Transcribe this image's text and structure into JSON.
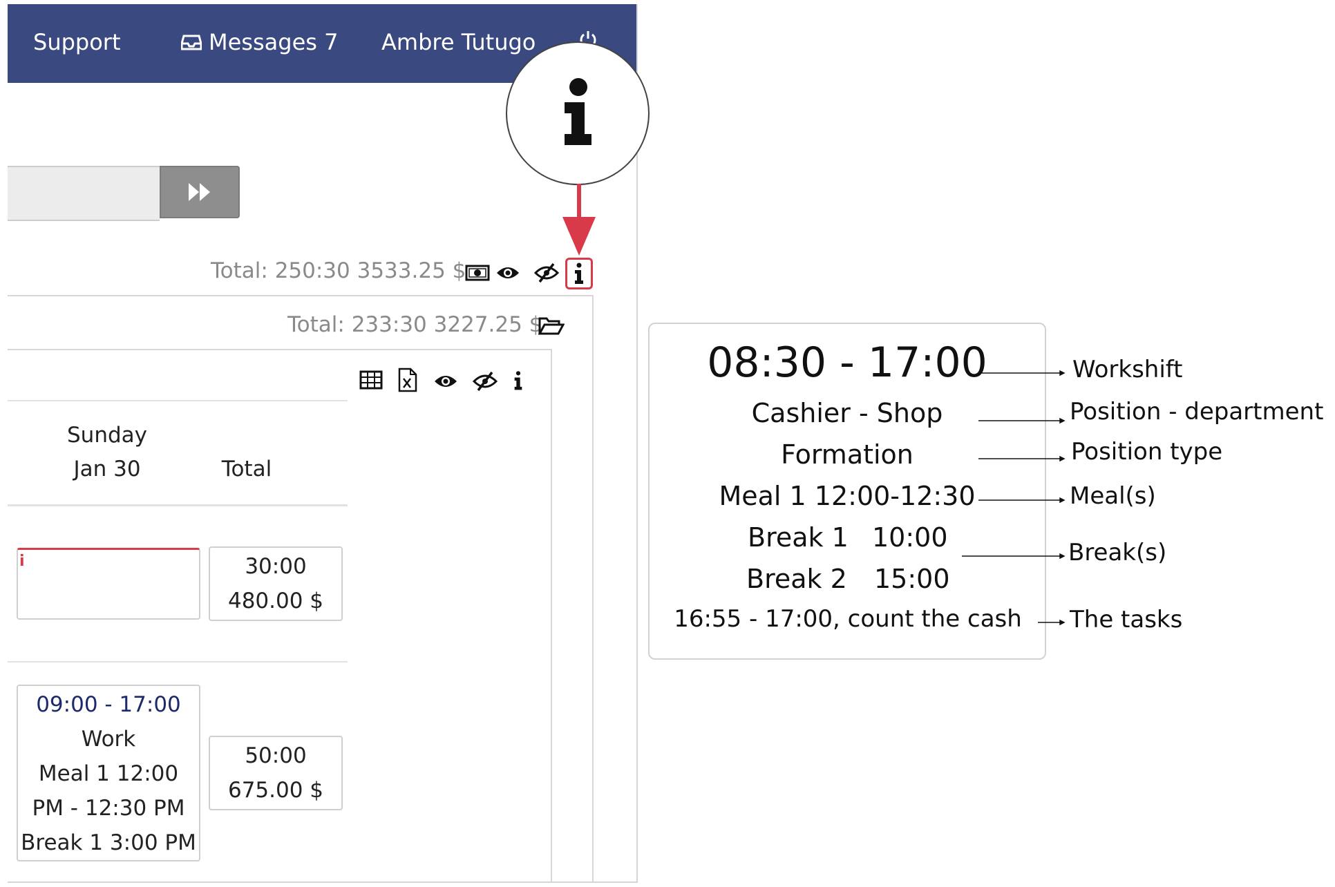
{
  "navbar": {
    "support_label": "Support",
    "messages_label": "Messages 7",
    "user_name": "Ambre Tutugo",
    "bg_color": "#3a4a80"
  },
  "totals": {
    "overall": "Total: 250:30 3533.25 $",
    "group": "Total: 233:30 3227.25 $"
  },
  "columns": {
    "day_name": "Sunday",
    "day_date": "Jan 30",
    "total": "Total"
  },
  "rows": [
    {
      "shift_lines": [],
      "has_info_flag": true,
      "info_flag": "i",
      "total_hours": "30:00",
      "total_pay": "480.00 $"
    },
    {
      "shift_time": "09:00 - 17:00",
      "shift_lines": [
        "Work",
        "Meal 1 12:00",
        "PM - 12:30 PM",
        "Break 1 3:00 PM"
      ],
      "total_hours": "50:00",
      "total_pay": "675.00 $"
    }
  ],
  "icons": {
    "toolbar_top": [
      "money-icon",
      "eye-icon",
      "eye-slash-icon",
      "info-icon"
    ],
    "group_header": [
      "folder-open-icon"
    ],
    "table_toolbar": [
      "table-icon",
      "excel-file-icon",
      "eye-icon",
      "eye-slash-icon",
      "info-icon"
    ]
  },
  "legend": {
    "workshift": "08:30 - 17:00",
    "position_department": "Cashier - Shop",
    "position_type": "Formation",
    "meal": "Meal 1 12:00-12:30",
    "break1_label": "Break 1",
    "break1_time": "10:00",
    "break2_label": "Break 2",
    "break2_time": "15:00",
    "tasks": "16:55 - 17:00, count the cash"
  },
  "annotations": {
    "workshift": "Workshift",
    "position_department": "Position - department",
    "position_type": "Position type",
    "meals": "Meal(s)",
    "breaks": "Break(s)",
    "tasks": "The tasks"
  },
  "colors": {
    "highlight_red": "#d93a49",
    "muted_text": "#8a8a8a",
    "shift_time_blue": "#1c2a6b"
  }
}
